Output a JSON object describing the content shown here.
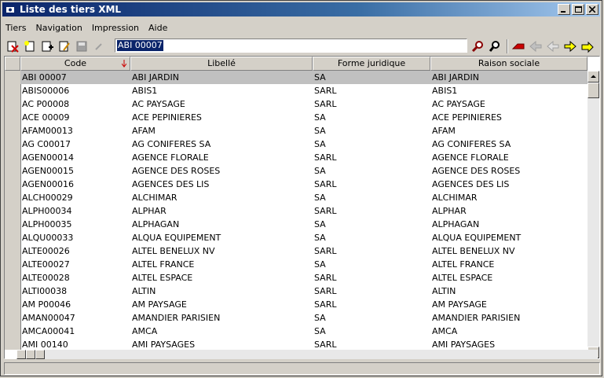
{
  "window": {
    "title": "Liste des tiers XML"
  },
  "menu": [
    {
      "label": "Tiers"
    },
    {
      "label": "Navigation"
    },
    {
      "label": "Impression"
    },
    {
      "label": "Aide"
    }
  ],
  "search": {
    "value": "ABI 00007"
  },
  "columns": [
    "Code",
    "Libellé",
    "Forme juridique",
    "Raison sociale"
  ],
  "rows": [
    {
      "code": "ABI 00007",
      "libelle": "ABI JARDIN",
      "forme": "SA",
      "raison": "ABI JARDIN"
    },
    {
      "code": "ABIS00006",
      "libelle": "ABIS1",
      "forme": "SARL",
      "raison": "ABIS1"
    },
    {
      "code": "AC P00008",
      "libelle": "AC PAYSAGE",
      "forme": "SARL",
      "raison": "AC PAYSAGE"
    },
    {
      "code": "ACE 00009",
      "libelle": "ACE PEPINIERES",
      "forme": "SA",
      "raison": "ACE PEPINIERES"
    },
    {
      "code": "AFAM00013",
      "libelle": "AFAM",
      "forme": "SA",
      "raison": "AFAM"
    },
    {
      "code": "AG C00017",
      "libelle": "AG CONIFERES SA",
      "forme": "SA",
      "raison": "AG CONIFERES SA"
    },
    {
      "code": "AGEN00014",
      "libelle": "AGENCE FLORALE",
      "forme": "SARL",
      "raison": "AGENCE FLORALE"
    },
    {
      "code": "AGEN00015",
      "libelle": "AGENCE DES ROSES",
      "forme": "SA",
      "raison": "AGENCE DES ROSES"
    },
    {
      "code": "AGEN00016",
      "libelle": "AGENCES DES LIS",
      "forme": "SARL",
      "raison": "AGENCES DES LIS"
    },
    {
      "code": "ALCH00029",
      "libelle": "ALCHIMAR",
      "forme": "SA",
      "raison": "ALCHIMAR"
    },
    {
      "code": "ALPH00034",
      "libelle": "ALPHAR",
      "forme": "SARL",
      "raison": "ALPHAR"
    },
    {
      "code": "ALPH00035",
      "libelle": "ALPHAGAN",
      "forme": "SA",
      "raison": "ALPHAGAN"
    },
    {
      "code": "ALQU00033",
      "libelle": "ALQUA EQUIPEMENT",
      "forme": "SA",
      "raison": "ALQUA EQUIPEMENT"
    },
    {
      "code": "ALTE00026",
      "libelle": "ALTEL BENELUX NV",
      "forme": "SARL",
      "raison": "ALTEL BENELUX NV"
    },
    {
      "code": "ALTE00027",
      "libelle": "ALTEL  FRANCE",
      "forme": "SA",
      "raison": "ALTEL  FRANCE"
    },
    {
      "code": "ALTE00028",
      "libelle": "ALTEL ESPACE",
      "forme": "SARL",
      "raison": "ALTEL ESPACE"
    },
    {
      "code": "ALTI00038",
      "libelle": "ALTIN",
      "forme": "SARL",
      "raison": "ALTIN"
    },
    {
      "code": "AM P00046",
      "libelle": "AM PAYSAGE",
      "forme": "SARL",
      "raison": "AM PAYSAGE"
    },
    {
      "code": "AMAN00047",
      "libelle": "AMANDIER PARISIEN",
      "forme": "SA",
      "raison": "AMANDIER PARISIEN"
    },
    {
      "code": "AMCA00041",
      "libelle": "AMCA",
      "forme": "SA",
      "raison": "AMCA"
    },
    {
      "code": "AMI 00140",
      "libelle": "AMI PAYSAGES",
      "forme": "SARL",
      "raison": "AMI PAYSAGES"
    }
  ],
  "scroll_position": 0
}
